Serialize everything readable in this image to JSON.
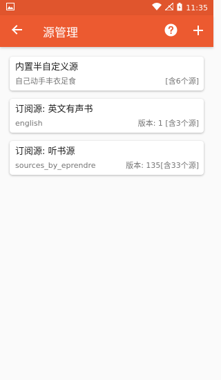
{
  "status": {
    "time": "11:35"
  },
  "appbar": {
    "title": "源管理"
  },
  "sources": [
    {
      "name": "内置半自定义源",
      "subtitle": "自己动手丰衣足食",
      "meta": "[含6个源]"
    },
    {
      "name": "订阅源: 英文有声书",
      "subtitle": "english",
      "meta": "版本: 1 [含3个源]"
    },
    {
      "name": "订阅源: 听书源",
      "subtitle": "sources_by_eprendre",
      "meta": "版本: 135[含33个源]"
    }
  ],
  "colors": {
    "statusbar": "#e0552d",
    "appbar": "#ec5a30"
  }
}
